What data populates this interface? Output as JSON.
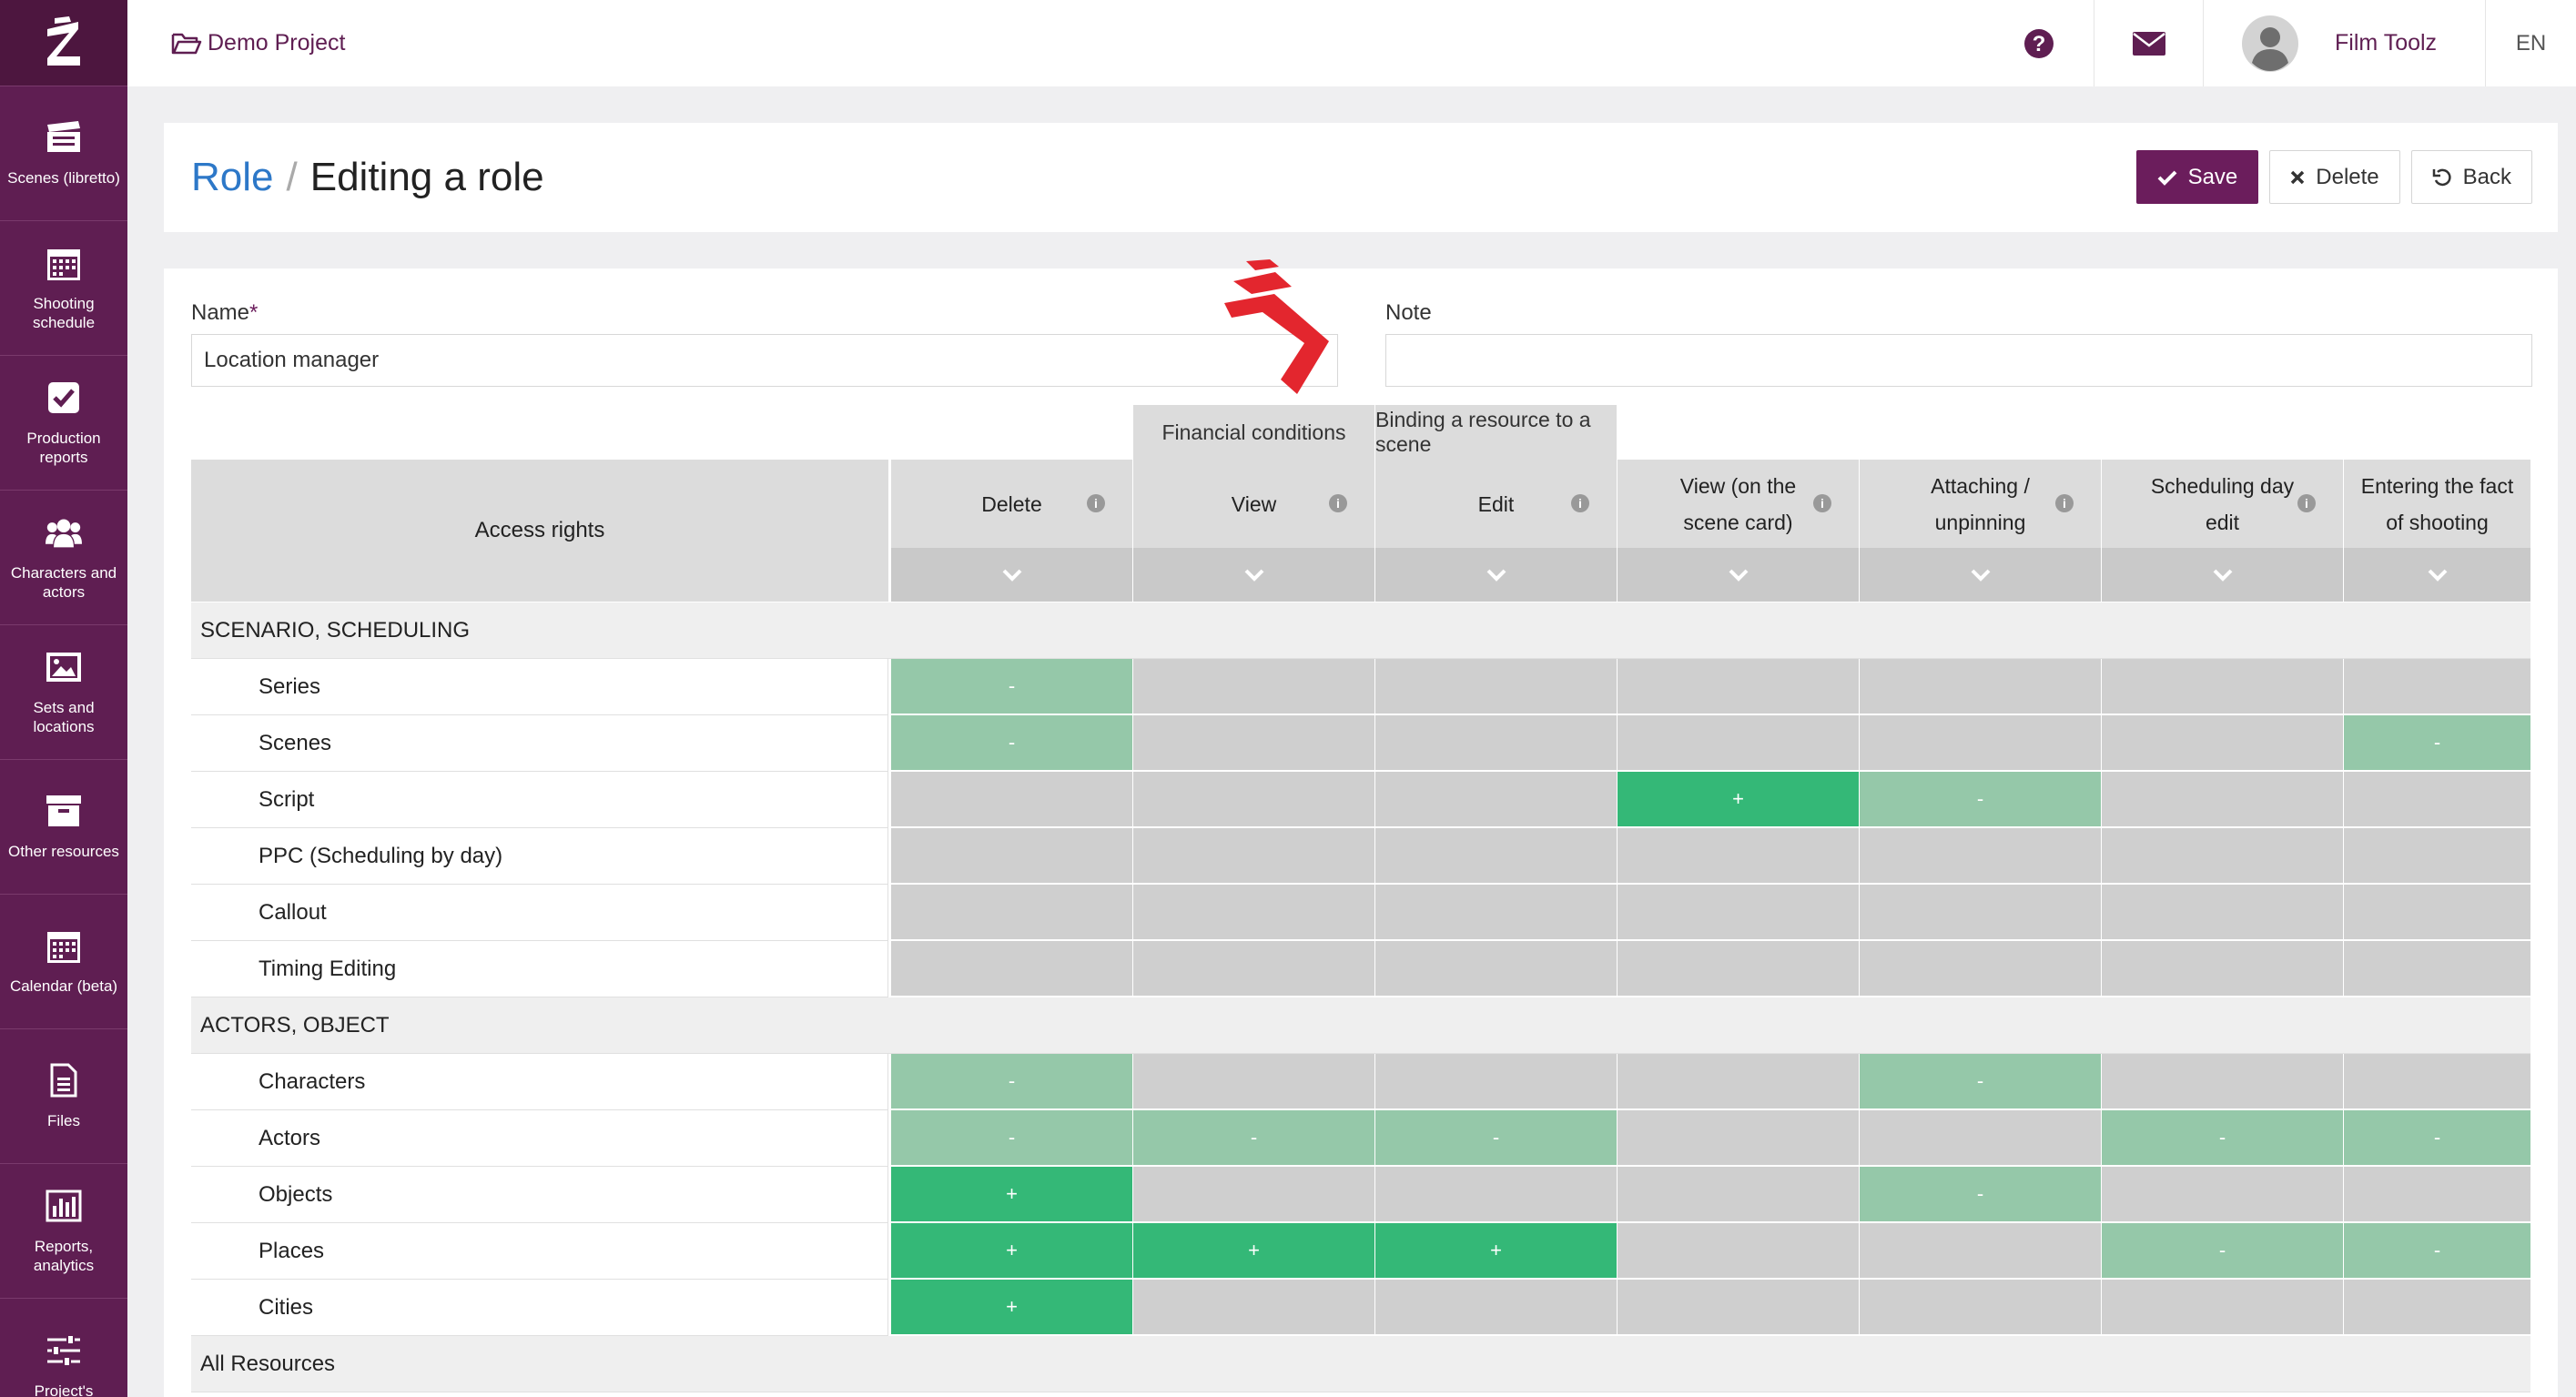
{
  "app": {
    "project_name": "Demo Project",
    "user_name": "Film Toolz",
    "language": "EN"
  },
  "sidebar": {
    "items": [
      {
        "label": "Scenes (libretto)",
        "icon": "clapperboard-icon"
      },
      {
        "label": "Shooting schedule",
        "icon": "calendar-icon"
      },
      {
        "label": "Production reports",
        "icon": "checkbox-icon"
      },
      {
        "label": "Characters and actors",
        "icon": "users-icon"
      },
      {
        "label": "Sets and locations",
        "icon": "image-icon"
      },
      {
        "label": "Other resources",
        "icon": "archive-icon"
      },
      {
        "label": "Calendar (beta)",
        "icon": "calendar-icon"
      },
      {
        "label": "Files",
        "icon": "file-icon"
      },
      {
        "label": "Reports, analytics",
        "icon": "bar-chart-icon"
      },
      {
        "label": "Project's",
        "icon": "sliders-icon"
      }
    ]
  },
  "header": {
    "breadcrumb": "Role",
    "separator": "/",
    "title": "Editing a role",
    "save_label": "Save",
    "delete_label": "Delete",
    "back_label": "Back"
  },
  "form": {
    "name_label": "Name",
    "required_mark": "*",
    "name_value": "Location manager",
    "note_label": "Note",
    "note_value": ""
  },
  "table": {
    "access_rights_label": "Access rights",
    "groups": [
      "Financial conditions",
      "Binding a resource to a scene"
    ],
    "columns": [
      {
        "line1": "Delete",
        "line2": "",
        "info": "i"
      },
      {
        "line1": "View",
        "line2": "",
        "info": "i"
      },
      {
        "line1": "Edit",
        "line2": "",
        "info": "i"
      },
      {
        "line1": "View (on the",
        "line2": "scene card)",
        "info": "i"
      },
      {
        "line1": "Attaching /",
        "line2": "unpinning",
        "info": "i"
      },
      {
        "line1": "Scheduling day",
        "line2": "edit",
        "info": "i"
      },
      {
        "line1": "Entering the fact",
        "line2": "of shooting",
        "info": ""
      }
    ],
    "sections": [
      {
        "title": "SCENARIO, SCHEDULING",
        "rows": [
          {
            "label": "Series",
            "cells": [
              "-",
              "",
              "",
              "",
              "",
              "",
              ""
            ],
            "states": [
              "light",
              "none",
              "none",
              "none",
              "none",
              "none",
              "none"
            ]
          },
          {
            "label": "Scenes",
            "cells": [
              "-",
              "",
              "",
              "",
              "",
              "",
              "-"
            ],
            "states": [
              "light",
              "none",
              "none",
              "none",
              "none",
              "none",
              "light"
            ]
          },
          {
            "label": "Script",
            "cells": [
              "",
              "",
              "",
              "+",
              "-",
              "",
              ""
            ],
            "states": [
              "none",
              "none",
              "none",
              "strong",
              "light",
              "none",
              "none"
            ]
          },
          {
            "label": "PPC (Scheduling by day)",
            "cells": [
              "",
              "",
              "",
              "",
              "",
              "",
              ""
            ],
            "states": [
              "none",
              "none",
              "none",
              "none",
              "none",
              "none",
              "none"
            ]
          },
          {
            "label": "Callout",
            "cells": [
              "",
              "",
              "",
              "",
              "",
              "",
              ""
            ],
            "states": [
              "none",
              "none",
              "none",
              "none",
              "none",
              "none",
              "none"
            ]
          },
          {
            "label": "Timing Editing",
            "cells": [
              "",
              "",
              "",
              "",
              "",
              "",
              ""
            ],
            "states": [
              "none",
              "none",
              "none",
              "none",
              "none",
              "none",
              "none"
            ]
          }
        ]
      },
      {
        "title": "ACTORS, OBJECT",
        "rows": [
          {
            "label": "Characters",
            "cells": [
              "-",
              "",
              "",
              "",
              "-",
              "",
              ""
            ],
            "states": [
              "light",
              "none",
              "none",
              "none",
              "light",
              "none",
              "none"
            ]
          },
          {
            "label": "Actors",
            "cells": [
              "-",
              "-",
              "-",
              "",
              "",
              "-",
              "-"
            ],
            "states": [
              "light",
              "light",
              "light",
              "none",
              "none",
              "light",
              "light"
            ]
          },
          {
            "label": "Objects",
            "cells": [
              "+",
              "",
              "",
              "",
              "-",
              "",
              ""
            ],
            "states": [
              "strong",
              "none",
              "none",
              "none",
              "light",
              "none",
              "none"
            ]
          },
          {
            "label": "Places",
            "cells": [
              "+",
              "+",
              "+",
              "",
              "",
              "-",
              "-"
            ],
            "states": [
              "strong",
              "strong",
              "strong",
              "none",
              "none",
              "light",
              "light"
            ]
          },
          {
            "label": "Cities",
            "cells": [
              "+",
              "",
              "",
              "",
              "",
              "",
              ""
            ],
            "states": [
              "strong",
              "none",
              "none",
              "none",
              "none",
              "none",
              "none"
            ]
          }
        ]
      },
      {
        "title": "All Resources",
        "rows": []
      }
    ]
  },
  "colors": {
    "brand": "#5f1e52",
    "link": "#2d78c8",
    "cell_empty": "#cfcfcf",
    "cell_light": "#95c8a9",
    "cell_strong": "#34b877"
  }
}
